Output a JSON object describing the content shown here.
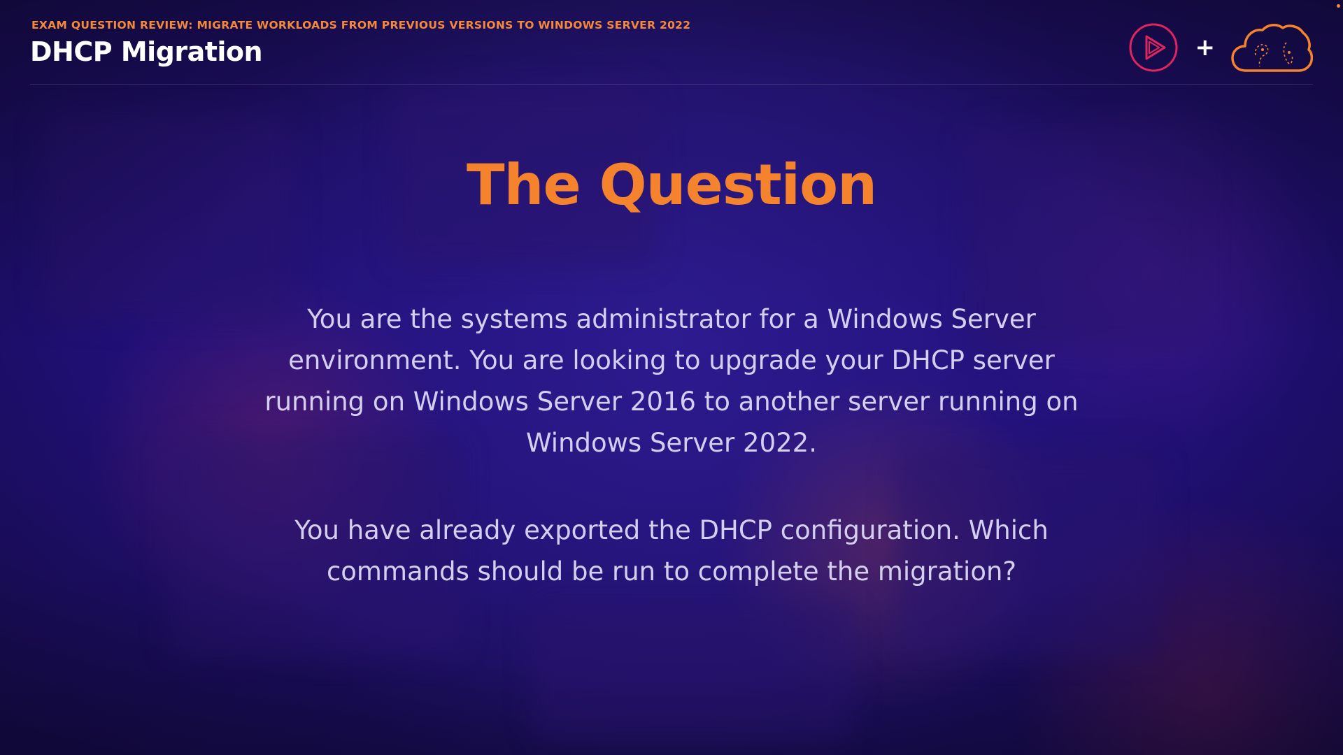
{
  "header": {
    "eyebrow": "EXAM QUESTION REVIEW: MIGRATE WORKLOADS FROM PREVIOUS VERSIONS TO WINDOWS SERVER 2022",
    "title": "DHCP Migration"
  },
  "logos": {
    "left_logo_icon": "play-circle-logo-icon",
    "separator": "+",
    "right_logo_icon": "cloud-logo-icon"
  },
  "slide": {
    "heading": "The Question",
    "paragraphs": [
      "You are the systems administrator for a Windows Server environment. You are looking to upgrade your DHCP server running on Windows Server 2016 to another server running on Windows Server 2022.",
      "You have already exported the DHCP configuration. Which commands should be run to complete the migration?"
    ]
  },
  "colors": {
    "accent_orange": "#f5832d",
    "eyebrow_orange": "#f5893a",
    "play_logo_pink": "#e0245e",
    "title_white": "#ffffff",
    "body_text": "#d4ceef",
    "background": "#1d0f5e"
  }
}
